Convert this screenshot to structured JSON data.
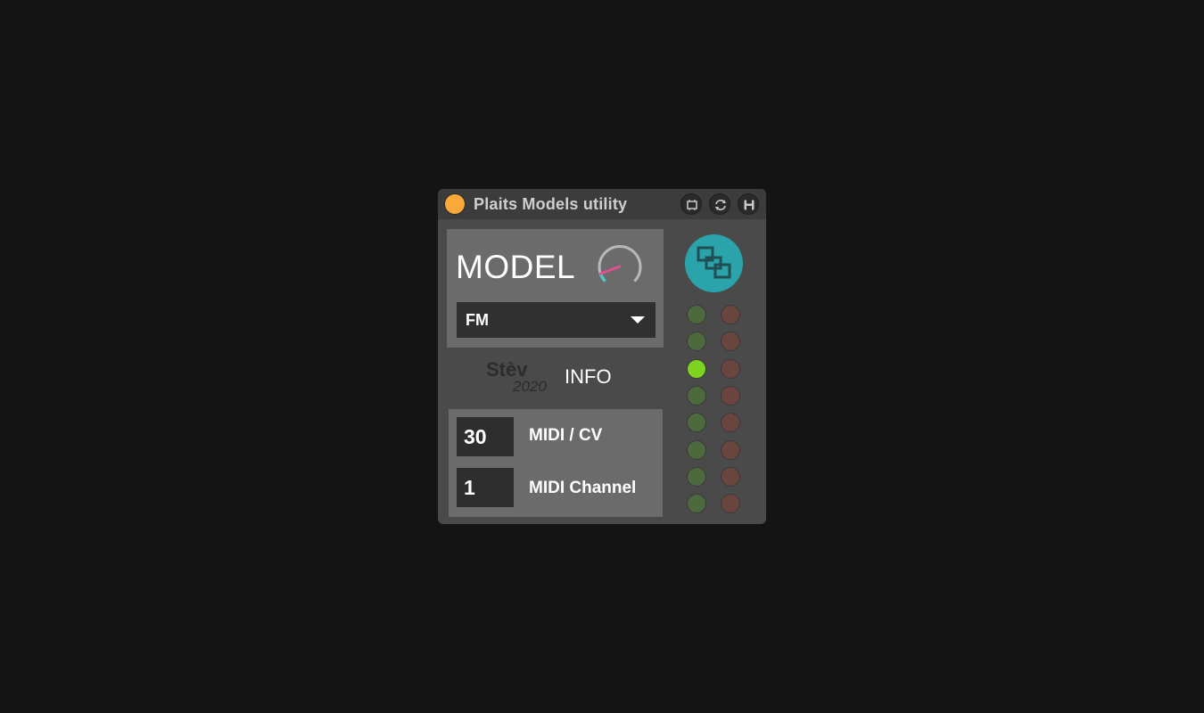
{
  "device": {
    "title": "Plaits Models utility",
    "power_color": "#f9a83a",
    "title_icons": [
      "window-icon",
      "refresh-icon",
      "save-icon"
    ]
  },
  "model_section": {
    "label": "MODEL",
    "knob": {
      "accent_color": "#e0508e",
      "track_color": "#4fc6c6"
    },
    "dropdown": {
      "selected": "FM"
    }
  },
  "brand": {
    "name": "Stèv",
    "year": "2020"
  },
  "info_button": {
    "label": "INFO"
  },
  "midi_section": {
    "cv_value": "30",
    "cv_label": "MIDI / CV",
    "channel_value": "1",
    "channel_label": "MIDI Channel"
  },
  "connect_button": {
    "icon": "map-icon",
    "color": "#2ba3ab"
  },
  "leds": {
    "active_index": 2,
    "green_on": "#7ed321",
    "green_off": "#4c6a3e",
    "red_off": "#6a4540",
    "rows": 8
  }
}
